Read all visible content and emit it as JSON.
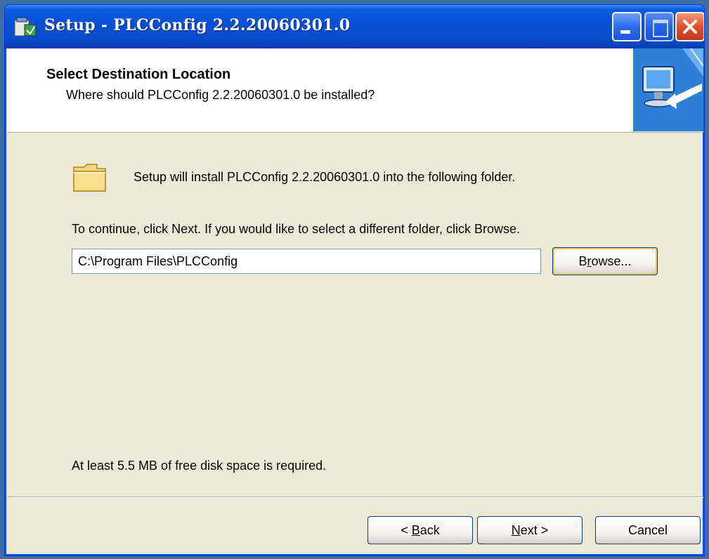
{
  "window": {
    "title": "Setup - PLCConfig 2.2.20060301.0"
  },
  "header": {
    "title": "Select Destination Location",
    "subtitle": "Where should PLCConfig 2.2.20060301.0 be installed?"
  },
  "body": {
    "install_message": "Setup will install PLCConfig 2.2.20060301.0 into the following folder.",
    "continue_message": "To continue, click Next. If you would like to select a different folder, click Browse.",
    "path_value": "C:\\Program Files\\PLCConfig",
    "browse_label_pre": "B",
    "browse_label_mnemonic": "r",
    "browse_label_post": "owse...",
    "disk_space_message": "At least 5.5 MB of free disk space is required."
  },
  "footer": {
    "back_pre": "< ",
    "back_mnemonic": "B",
    "back_post": "ack",
    "next_mnemonic": "N",
    "next_post": "ext >",
    "cancel_label": "Cancel"
  },
  "colors": {
    "titlebar": "#0a4fd6",
    "window_bg": "#ece9d8",
    "header_bg": "#ffffff"
  }
}
